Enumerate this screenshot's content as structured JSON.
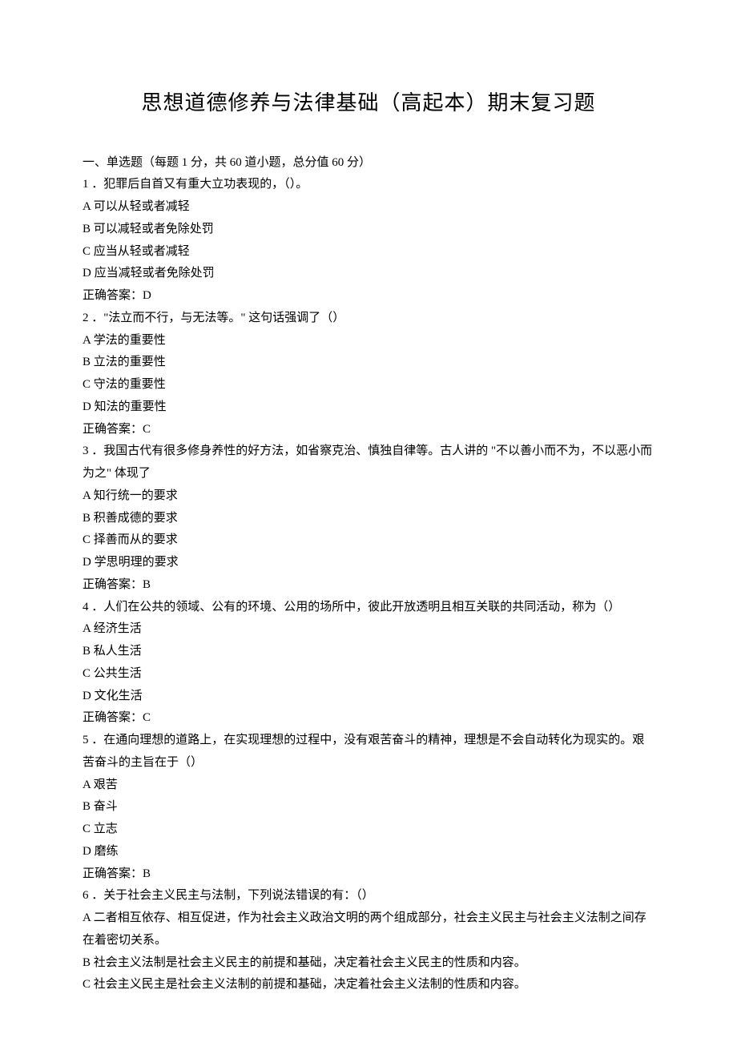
{
  "title": "思想道德修养与法律基础（高起本）期末复习题",
  "section_header": "一、单选题（每题 1 分，共 60 道小题，总分值 60 分）",
  "questions": [
    {
      "num": "1",
      "stem": "．犯罪后自首又有重大立功表现的，（）。",
      "options": {
        "A": "A 可以从轻或者减轻",
        "B": "B 可以减轻或者免除处罚",
        "C": "C 应当从轻或者减轻",
        "D": "D 应当减轻或者免除处罚"
      },
      "answer": "正确答案：D"
    },
    {
      "num": "2",
      "stem": "．\"法立而不行，与无法等。\" 这句话强调了（）",
      "options": {
        "A": "A 学法的重要性",
        "B": "B 立法的重要性",
        "C": "C 守法的重要性",
        "D": "D 知法的重要性"
      },
      "answer": "正确答案：C"
    },
    {
      "num": "3",
      "stem": "．我国古代有很多修身养性的好方法，如省察克治、慎独自律等。古人讲的 \"不以善小而不为，不以恶小而为之\" 体现了",
      "options": {
        "A": "A 知行统一的要求",
        "B": "B 积善成德的要求",
        "C": "C 择善而从的要求",
        "D": "D 学思明理的要求"
      },
      "answer": "正确答案：B"
    },
    {
      "num": "4",
      "stem": "．人们在公共的领域、公有的环境、公用的场所中，彼此开放透明且相互关联的共同活动，称为（）",
      "options": {
        "A": "A 经济生活",
        "B": "B 私人生活",
        "C": "C 公共生活",
        "D": "D 文化生活"
      },
      "answer": "正确答案：C"
    },
    {
      "num": "5",
      "stem": "．在通向理想的道路上，在实现理想的过程中，没有艰苦奋斗的精神，理想是不会自动转化为现实的。艰苦奋斗的主旨在于（）",
      "options": {
        "A": "A 艰苦",
        "B": "B 奋斗",
        "C": "C 立志",
        "D": "D 磨练"
      },
      "answer": "正确答案：B"
    },
    {
      "num": "6",
      "stem": "．关于社会主义民主与法制，下列说法错误的有：（）",
      "options": {
        "A": "A 二者相互依存、相互促进，作为社会主义政治文明的两个组成部分，社会主义民主与社会主义法制之间存在着密切关系。",
        "B": "B 社会主义法制是社会主义民主的前提和基础，决定着社会主义民主的性质和内容。",
        "C": "C 社会主义民主是社会主义法制的前提和基础，决定着社会主义法制的性质和内容。"
      },
      "answer": ""
    }
  ]
}
